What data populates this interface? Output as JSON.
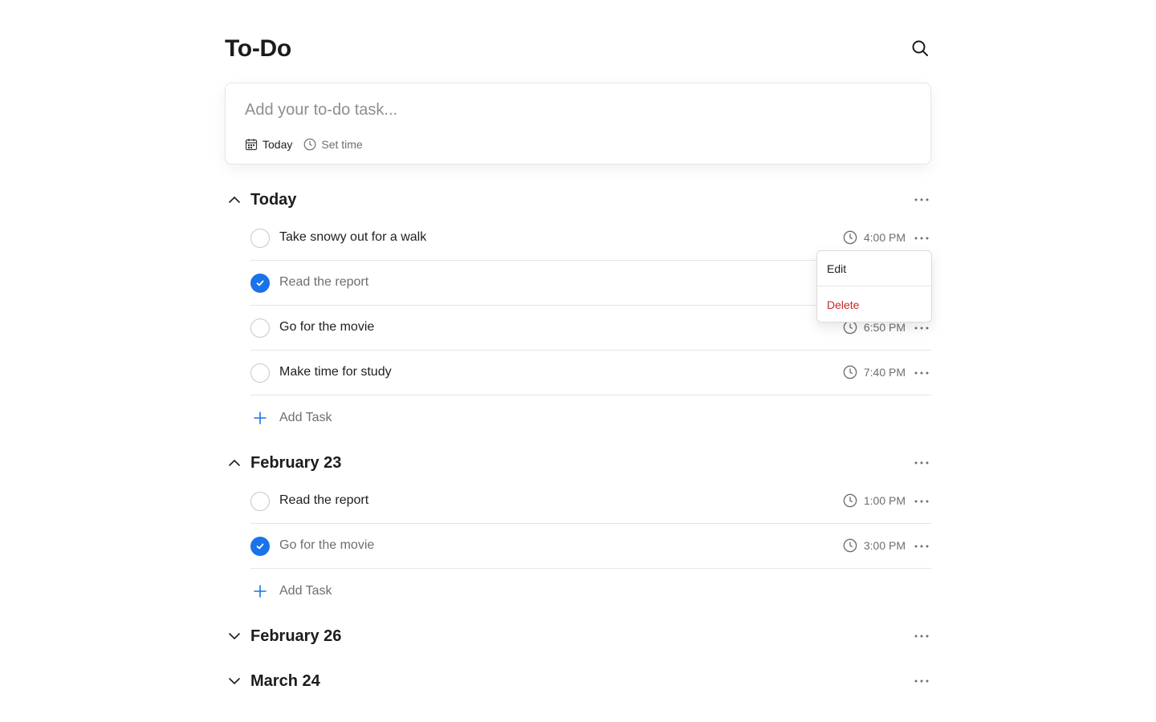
{
  "header": {
    "title": "To-Do"
  },
  "composer": {
    "placeholder": "Add your to-do task...",
    "date_label": "Today",
    "time_label": "Set time"
  },
  "groups": [
    {
      "title": "Today",
      "expanded": true,
      "tasks": [
        {
          "title": "Take snowy out for a walk",
          "time": "4:00 PM",
          "done": false
        },
        {
          "title": "Read the report",
          "time": "",
          "done": true
        },
        {
          "title": "Go for the movie",
          "time": "6:50 PM",
          "done": false
        },
        {
          "title": "Make time for study",
          "time": "7:40 PM",
          "done": false
        }
      ],
      "add_label": "Add Task"
    },
    {
      "title": "February 23",
      "expanded": true,
      "tasks": [
        {
          "title": "Read the report",
          "time": "1:00 PM",
          "done": false
        },
        {
          "title": "Go for the movie",
          "time": "3:00 PM",
          "done": true
        }
      ],
      "add_label": "Add Task"
    },
    {
      "title": "February 26",
      "expanded": false
    },
    {
      "title": "March 24",
      "expanded": false
    }
  ],
  "context_menu": {
    "edit": "Edit",
    "delete": "Delete"
  },
  "colors": {
    "accent": "#1a73e8",
    "danger": "#c62828",
    "muted": "#6e6e73",
    "divider": "#e5e5e5"
  },
  "icons": {
    "search": "search-icon",
    "calendar": "calendar-icon",
    "clock": "clock-icon",
    "chevron_up": "chevron-up-icon",
    "chevron_down": "chevron-down-icon",
    "more": "more-icon",
    "plus": "plus-icon",
    "check": "checkmark-icon"
  }
}
